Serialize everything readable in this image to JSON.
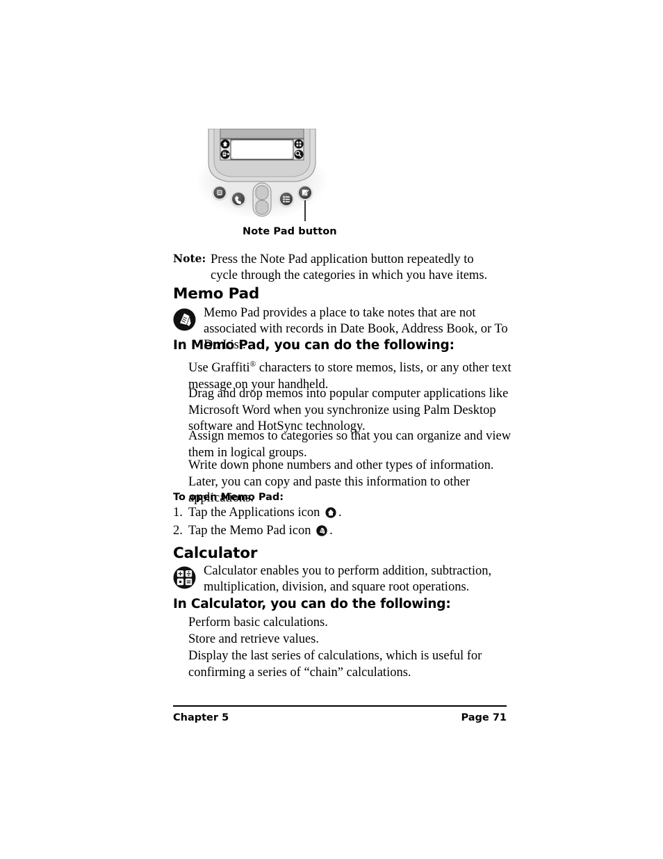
{
  "figure": {
    "caption": "Note Pad button",
    "device_icons": {
      "top_left": "home-icon",
      "bottom_left": "menu-icon",
      "top_right": "calculator-grid-icon",
      "bottom_right": "find-icon"
    },
    "buttons": [
      "date-book-button",
      "phone-button",
      "scroll-rocker",
      "to-do-list-button",
      "note-pad-button"
    ]
  },
  "note": {
    "label": "Note:",
    "text": "Press the Note Pad application button repeatedly to cycle through the categories in which you have items."
  },
  "memo_pad": {
    "heading": "Memo Pad",
    "icon": "memo-pad-icon",
    "intro": "Memo Pad provides a place to take notes that are not associated with records in Date Book, Address Book, or To Do List.",
    "subheading": "In Memo Pad, you can do the following:",
    "features": [
      "Use Graffiti® characters to store memos, lists, or any other text message on your handheld.",
      "Drag and drop memos into popular computer applications like Microsoft Word when you synchronize using Palm Desktop software and HotSync technology.",
      "Assign memos to categories so that you can organize and view them in logical groups.",
      "Write down phone numbers and other types of information. Later, you can copy and paste this information to other applications."
    ],
    "open_heading": "To open Memo Pad:",
    "steps": [
      {
        "num": "1.",
        "before": "Tap the Applications icon",
        "icon": "applications-home-icon",
        "after": "."
      },
      {
        "num": "2.",
        "before": "Tap the Memo Pad icon",
        "icon": "memo-pad-icon",
        "after": "."
      }
    ]
  },
  "calculator": {
    "heading": "Calculator",
    "icon": "calculator-icon",
    "intro": "Calculator enables you to perform addition, subtraction, multiplication, division, and square root operations.",
    "subheading": "In Calculator, you can do the following:",
    "features": [
      "Perform basic calculations.",
      "Store and retrieve values.",
      "Display the last series of calculations, which is useful for confirming a series of “chain” calculations."
    ]
  },
  "footer": {
    "left": "Chapter 5",
    "right": "Page 71"
  },
  "colors": {
    "text": "#000000",
    "background": "#ffffff",
    "device_body": "#d9d9d9",
    "device_screen": "#ffffff",
    "device_top_band": "#b5b5b5",
    "button_dark": "#4f4f4f"
  }
}
